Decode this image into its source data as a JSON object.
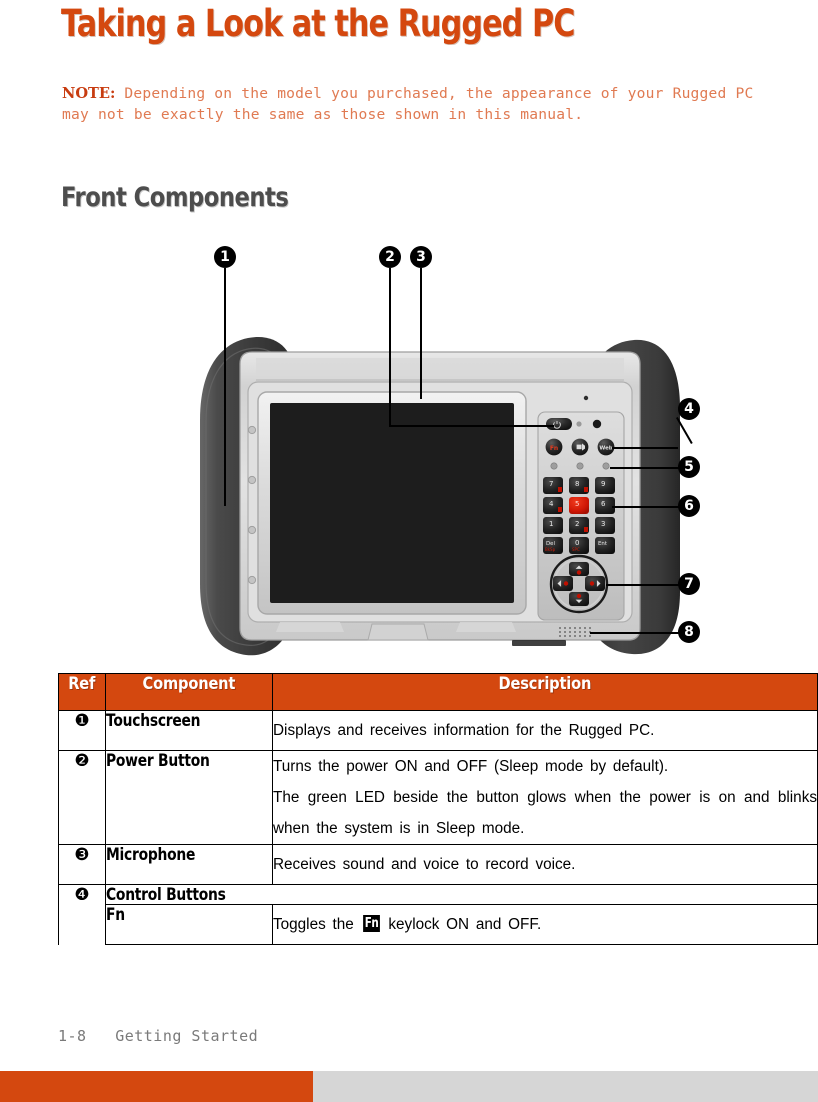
{
  "document": {
    "chapter_title": "Taking a Look at the Rugged PC",
    "note": {
      "label": "NOTE:",
      "text": " Depending on the model you purchased, the appearance of your Rugged PC may not be exactly the same as those shown in this manual."
    },
    "section_title": "Front Components"
  },
  "colors": {
    "accent_orange": "#D4480F",
    "note_text": "#E07A52",
    "note_label": "#C83C10",
    "section_grey": "#4D4D4D",
    "footer_grey": "#D6D6D6",
    "key_red": "#D81E05"
  },
  "figure": {
    "alt": "Front view of the Rugged PC tablet with numbered callouts",
    "callouts": [
      {
        "number": "1",
        "target": "touchscreen"
      },
      {
        "number": "2",
        "target": "power-button"
      },
      {
        "number": "3",
        "target": "microphone"
      },
      {
        "number": "4",
        "target": "control-buttons"
      },
      {
        "number": "5",
        "target": "indicators"
      },
      {
        "number": "6",
        "target": "numeric-keypad"
      },
      {
        "number": "7",
        "target": "navigation-pad"
      },
      {
        "number": "8",
        "target": "speaker"
      }
    ],
    "device": {
      "round_buttons": [
        "Fn",
        "volume-icon",
        "Web"
      ],
      "keypad_rows": [
        [
          "7",
          "8",
          "9"
        ],
        [
          "4",
          "5",
          "6"
        ],
        [
          "1",
          "2",
          "3"
        ],
        [
          "Del",
          "0",
          "Ent"
        ]
      ],
      "highlight_key": "5"
    }
  },
  "table": {
    "headers": [
      "Ref",
      "Component",
      "Description"
    ],
    "rows": [
      {
        "ref": "❶",
        "component": "Touchscreen",
        "description": [
          "Displays and receives information for the Rugged PC."
        ],
        "justify": true
      },
      {
        "ref": "❷",
        "component": "Power Button",
        "description": [
          "Turns the power ON and OFF (Sleep mode by default).",
          "The green LED beside the button glows when the power is on and blinks when the system is in Sleep mode."
        ],
        "justify": true
      },
      {
        "ref": "❸",
        "component": "Microphone",
        "description": [
          "Receives sound and voice to record voice."
        ],
        "justify": true
      },
      {
        "ref": "❹",
        "component": "Control Buttons",
        "description": [],
        "group_header": true
      },
      {
        "ref": "",
        "component": "Fn",
        "description_prefix": "Toggles the ",
        "description_key": "Fn",
        "description_suffix": " keylock ON and OFF.",
        "sub_row": true
      }
    ]
  },
  "footer": {
    "page_number": "1-8",
    "chapter_name": "Getting Started"
  }
}
